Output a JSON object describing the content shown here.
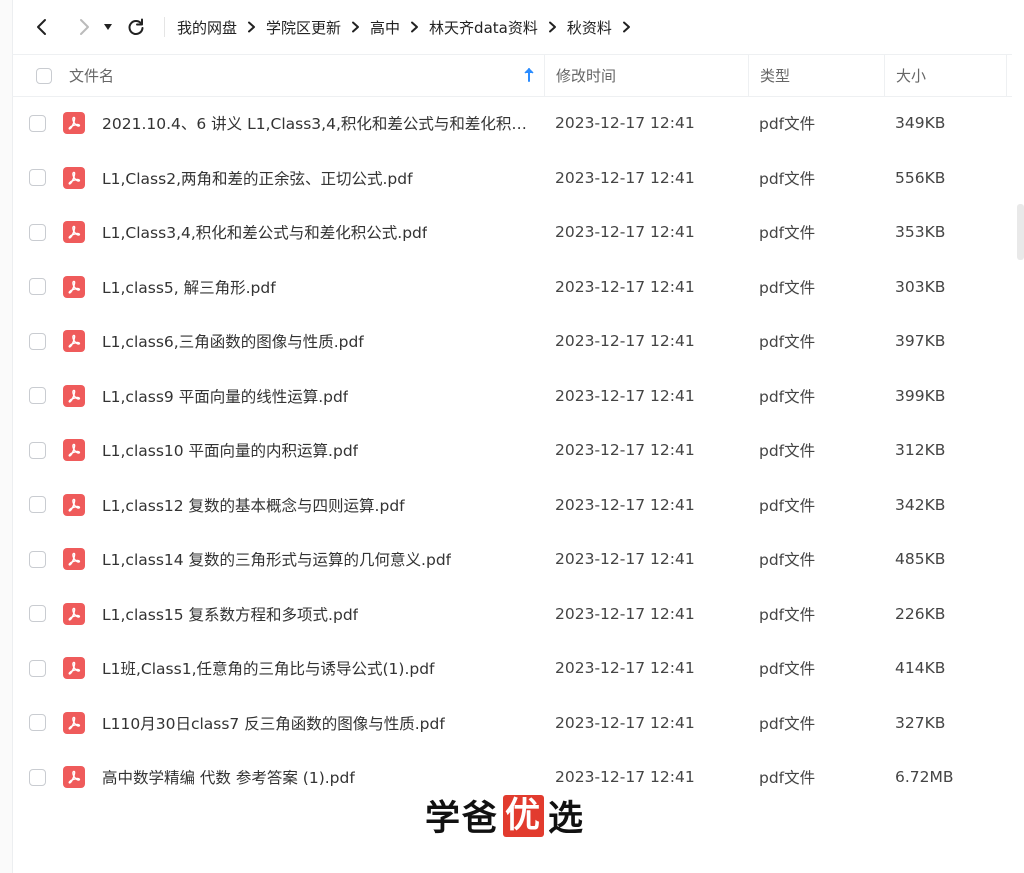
{
  "breadcrumb": [
    "我的网盘",
    "学院区更新",
    "高中",
    "林天齐data资料",
    "秋资料"
  ],
  "columns": {
    "name": "文件名",
    "modified": "修改时间",
    "type": "类型",
    "size": "大小"
  },
  "files": [
    {
      "name": "2021.10.4、6 讲义  L1,Class3,4,积化和差公式与和差化积…",
      "modified": "2023-12-17 12:41",
      "type": "pdf文件",
      "size": "349KB"
    },
    {
      "name": "L1,Class2,两角和差的正余弦、正切公式.pdf",
      "modified": "2023-12-17 12:41",
      "type": "pdf文件",
      "size": "556KB"
    },
    {
      "name": "L1,Class3,4,积化和差公式与和差化积公式.pdf",
      "modified": "2023-12-17 12:41",
      "type": "pdf文件",
      "size": "353KB"
    },
    {
      "name": "L1,class5, 解三角形.pdf",
      "modified": "2023-12-17 12:41",
      "type": "pdf文件",
      "size": "303KB"
    },
    {
      "name": "L1,class6,三角函数的图像与性质.pdf",
      "modified": "2023-12-17 12:41",
      "type": "pdf文件",
      "size": "397KB"
    },
    {
      "name": "L1,class9 平面向量的线性运算.pdf",
      "modified": "2023-12-17 12:41",
      "type": "pdf文件",
      "size": "399KB"
    },
    {
      "name": "L1,class10 平面向量的内积运算.pdf",
      "modified": "2023-12-17 12:41",
      "type": "pdf文件",
      "size": "312KB"
    },
    {
      "name": "L1,class12 复数的基本概念与四则运算.pdf",
      "modified": "2023-12-17 12:41",
      "type": "pdf文件",
      "size": "342KB"
    },
    {
      "name": "L1,class14 复数的三角形式与运算的几何意义.pdf",
      "modified": "2023-12-17 12:41",
      "type": "pdf文件",
      "size": "485KB"
    },
    {
      "name": "L1,class15 复系数方程和多项式.pdf",
      "modified": "2023-12-17 12:41",
      "type": "pdf文件",
      "size": "226KB"
    },
    {
      "name": "L1班,Class1,任意角的三角比与诱导公式(1).pdf",
      "modified": "2023-12-17 12:41",
      "type": "pdf文件",
      "size": "414KB"
    },
    {
      "name": "L110月30日class7 反三角函数的图像与性质.pdf",
      "modified": "2023-12-17 12:41",
      "type": "pdf文件",
      "size": "327KB"
    },
    {
      "name": "高中数学精编 代数  参考答案 (1).pdf",
      "modified": "2023-12-17 12:41",
      "type": "pdf文件",
      "size": "6.72MB"
    }
  ],
  "watermark": {
    "part1": "学爸",
    "highlight": "优",
    "part2": "选"
  },
  "colors": {
    "pdf_icon": "#ef5b5b",
    "sort_arrow": "#2b8cff",
    "watermark_box": "#e23b2e"
  },
  "icons": {
    "back": "chevron-left-icon",
    "forward": "chevron-right-icon",
    "history": "caret-down-icon",
    "refresh": "refresh-icon",
    "file": "pdf-icon",
    "sort": "arrow-up-icon"
  }
}
